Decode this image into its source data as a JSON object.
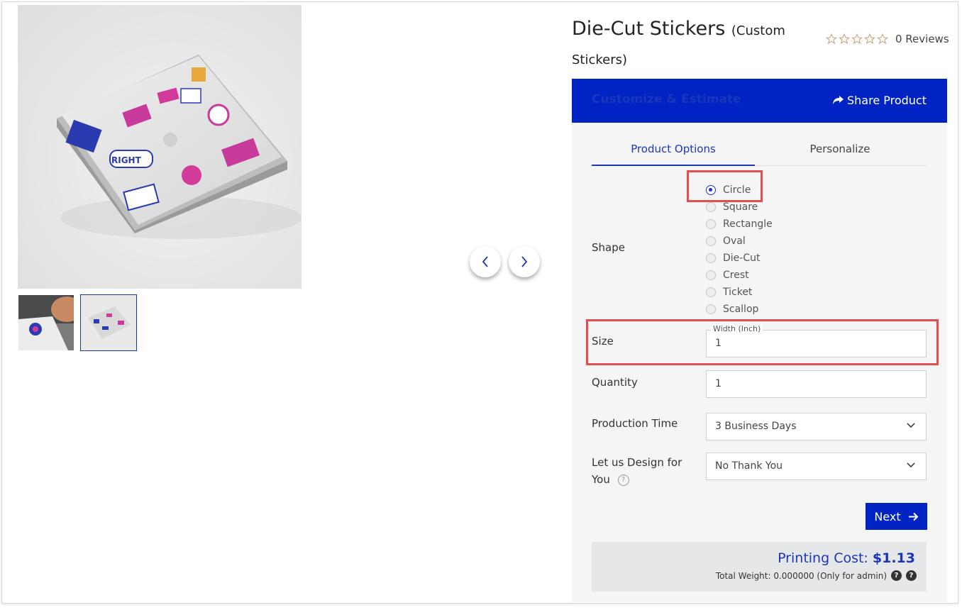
{
  "product": {
    "title": "Die-Cut Stickers",
    "subtitle_line1": "(Custom",
    "subtitle_line2": "Stickers)",
    "reviews": "0 Reviews",
    "rating": 0,
    "stars_total": 5
  },
  "gallery": {
    "main_image": "laptop-with-stickers-photo",
    "thumbnails": [
      "sticker-on-desk-photo",
      "laptop-with-stickers-photo"
    ],
    "selected_thumbnail": 1
  },
  "panel": {
    "header_title": "Customize & Estimate",
    "share_label": "Share Product",
    "tabs": [
      "Product Options",
      "Personalize"
    ],
    "active_tab": 0
  },
  "options": {
    "shape_label": "Shape",
    "shapes": [
      "Circle",
      "Square",
      "Rectangle",
      "Oval",
      "Die-Cut",
      "Crest",
      "Ticket",
      "Scallop"
    ],
    "selected_shape": "Circle",
    "size_label": "Size",
    "width_legend": "Width (Inch)",
    "width_value": "1",
    "quantity_label": "Quantity",
    "quantity_value": "1",
    "production_label": "Production Time",
    "production_value": "3 Business Days",
    "design_label_line1": "Let us Design for",
    "design_label_line2": "You",
    "design_value": "No Thank You",
    "next_label": "Next"
  },
  "cost": {
    "label": "Printing Cost:",
    "value": "$1.13",
    "weight_text": "Total Weight: 0.000000 (Only for admin)"
  },
  "colors": {
    "brand_blue": "#0023c4",
    "highlight_red": "#e0504f",
    "star_outline": "#c9a27a"
  }
}
